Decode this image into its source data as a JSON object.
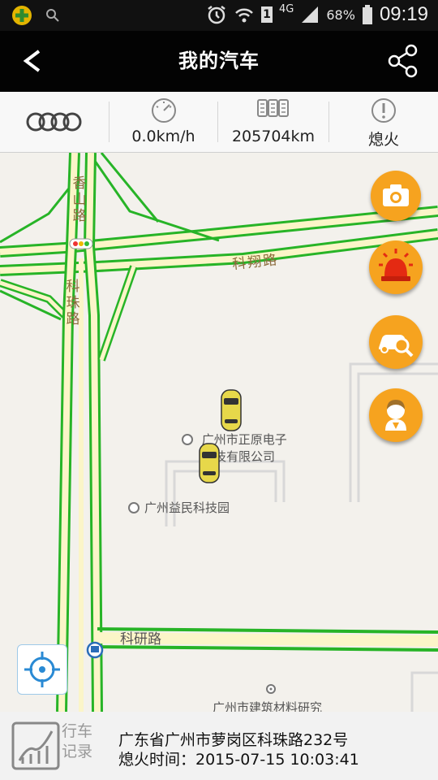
{
  "status_bar": {
    "network": "4G",
    "battery": "68%",
    "time": "09:19",
    "sim_slot": "1",
    "icons": [
      "app-notification-icon",
      "search-icon",
      "alarm-icon",
      "wifi-icon",
      "signal-icon",
      "battery-icon"
    ]
  },
  "header": {
    "back_icon": "back-icon",
    "title": "我的汽车",
    "share_icon": "share-icon"
  },
  "info": {
    "brand_logo": "audi-logo",
    "speed": "0.0km/h",
    "odometer": "205704km",
    "status": "熄火",
    "icons": [
      "speedometer-icon",
      "odometer-icon",
      "alert-icon"
    ]
  },
  "map": {
    "roads": {
      "xiangshan": "香山路",
      "kexiang": "科翔路",
      "kezhu": "科珠路",
      "keyan": "科研路"
    },
    "pois": [
      {
        "line1": "广州市正原电子",
        "line2": "技有限公司"
      },
      {
        "line1": "广州益民科技园"
      },
      {
        "line1": "广州市建筑材料研究"
      }
    ],
    "cars": [
      "car-marker-1",
      "car-marker-2"
    ],
    "buttons": [
      "camera-button",
      "alarm-button",
      "car-search-button",
      "assistant-button"
    ],
    "accent_color": "#f6a31f"
  },
  "bottom": {
    "record_line1": "行车",
    "record_line2": "记录",
    "address": "广东省广州市萝岗区科珠路232号",
    "ignition_time": "熄火时间：2015-07-15 10:03:41"
  }
}
